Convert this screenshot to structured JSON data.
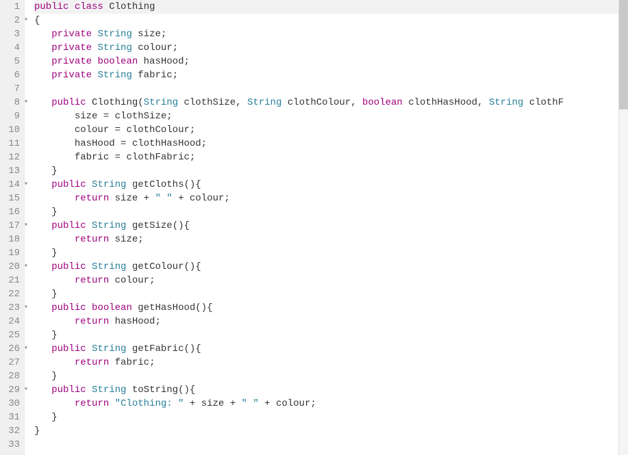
{
  "editor": {
    "activeLine": 1,
    "lines": [
      {
        "num": 1,
        "fold": "",
        "tokens": [
          [
            "kw",
            "public"
          ],
          [
            "",
            null
          ],
          [
            "kw",
            "class"
          ],
          [
            "",
            null
          ],
          [
            "ident",
            "Clothing"
          ]
        ]
      },
      {
        "num": 2,
        "fold": "▾",
        "tokens": [
          [
            "punc",
            "{"
          ]
        ]
      },
      {
        "num": 3,
        "fold": "",
        "tokens": [
          [
            "",
            "   "
          ],
          [
            "kw",
            "private"
          ],
          [
            "",
            null
          ],
          [
            "type",
            "String"
          ],
          [
            "",
            null
          ],
          [
            "ident",
            "size"
          ],
          [
            "punc",
            ";"
          ]
        ]
      },
      {
        "num": 4,
        "fold": "",
        "tokens": [
          [
            "",
            "   "
          ],
          [
            "kw",
            "private"
          ],
          [
            "",
            null
          ],
          [
            "type",
            "String"
          ],
          [
            "",
            null
          ],
          [
            "ident",
            "colour"
          ],
          [
            "punc",
            ";"
          ]
        ]
      },
      {
        "num": 5,
        "fold": "",
        "tokens": [
          [
            "",
            "   "
          ],
          [
            "kw",
            "private"
          ],
          [
            "",
            null
          ],
          [
            "kw",
            "boolean"
          ],
          [
            "",
            null
          ],
          [
            "ident",
            "hasHood"
          ],
          [
            "punc",
            ";"
          ]
        ]
      },
      {
        "num": 6,
        "fold": "",
        "tokens": [
          [
            "",
            "   "
          ],
          [
            "kw",
            "private"
          ],
          [
            "",
            null
          ],
          [
            "type",
            "String"
          ],
          [
            "",
            null
          ],
          [
            "ident",
            "fabric"
          ],
          [
            "punc",
            ";"
          ]
        ]
      },
      {
        "num": 7,
        "fold": "",
        "tokens": []
      },
      {
        "num": 8,
        "fold": "▾",
        "tokens": [
          [
            "",
            "   "
          ],
          [
            "kw",
            "public"
          ],
          [
            "",
            null
          ],
          [
            "ident",
            "Clothing"
          ],
          [
            "punc",
            "("
          ],
          [
            "type",
            "String"
          ],
          [
            "",
            null
          ],
          [
            "ident",
            "clothSize"
          ],
          [
            "punc",
            ","
          ],
          [
            "",
            null
          ],
          [
            "type",
            "String"
          ],
          [
            "",
            null
          ],
          [
            "ident",
            "clothColour"
          ],
          [
            "punc",
            ","
          ],
          [
            "",
            null
          ],
          [
            "kw",
            "boolean"
          ],
          [
            "",
            null
          ],
          [
            "ident",
            "clothHasHood"
          ],
          [
            "punc",
            ","
          ],
          [
            "",
            null
          ],
          [
            "type",
            "String"
          ],
          [
            "",
            null
          ],
          [
            "ident",
            "clothF"
          ]
        ]
      },
      {
        "num": 9,
        "fold": "",
        "tokens": [
          [
            "",
            "       "
          ],
          [
            "ident",
            "size"
          ],
          [
            "",
            null
          ],
          [
            "op",
            "="
          ],
          [
            "",
            null
          ],
          [
            "ident",
            "clothSize"
          ],
          [
            "punc",
            ";"
          ]
        ]
      },
      {
        "num": 10,
        "fold": "",
        "tokens": [
          [
            "",
            "       "
          ],
          [
            "ident",
            "colour"
          ],
          [
            "",
            null
          ],
          [
            "op",
            "="
          ],
          [
            "",
            null
          ],
          [
            "ident",
            "clothColour"
          ],
          [
            "punc",
            ";"
          ]
        ]
      },
      {
        "num": 11,
        "fold": "",
        "tokens": [
          [
            "",
            "       "
          ],
          [
            "ident",
            "hasHood"
          ],
          [
            "",
            null
          ],
          [
            "op",
            "="
          ],
          [
            "",
            null
          ],
          [
            "ident",
            "clothHasHood"
          ],
          [
            "punc",
            ";"
          ]
        ]
      },
      {
        "num": 12,
        "fold": "",
        "tokens": [
          [
            "",
            "       "
          ],
          [
            "ident",
            "fabric"
          ],
          [
            "",
            null
          ],
          [
            "op",
            "="
          ],
          [
            "",
            null
          ],
          [
            "ident",
            "clothFabric"
          ],
          [
            "punc",
            ";"
          ]
        ]
      },
      {
        "num": 13,
        "fold": "",
        "tokens": [
          [
            "",
            "   "
          ],
          [
            "punc",
            "}"
          ]
        ]
      },
      {
        "num": 14,
        "fold": "▾",
        "tokens": [
          [
            "",
            "   "
          ],
          [
            "kw",
            "public"
          ],
          [
            "",
            null
          ],
          [
            "type",
            "String"
          ],
          [
            "",
            null
          ],
          [
            "ident",
            "getCloths"
          ],
          [
            "punc",
            "(){"
          ]
        ]
      },
      {
        "num": 15,
        "fold": "",
        "tokens": [
          [
            "",
            "       "
          ],
          [
            "kw",
            "return"
          ],
          [
            "",
            null
          ],
          [
            "ident",
            "size"
          ],
          [
            "",
            null
          ],
          [
            "op",
            "+"
          ],
          [
            "",
            null
          ],
          [
            "str",
            "\" \""
          ],
          [
            "",
            null
          ],
          [
            "op",
            "+"
          ],
          [
            "",
            null
          ],
          [
            "ident",
            "colour"
          ],
          [
            "punc",
            ";"
          ]
        ]
      },
      {
        "num": 16,
        "fold": "",
        "tokens": [
          [
            "",
            "   "
          ],
          [
            "punc",
            "}"
          ]
        ]
      },
      {
        "num": 17,
        "fold": "▾",
        "tokens": [
          [
            "",
            "   "
          ],
          [
            "kw",
            "public"
          ],
          [
            "",
            null
          ],
          [
            "type",
            "String"
          ],
          [
            "",
            null
          ],
          [
            "ident",
            "getSize"
          ],
          [
            "punc",
            "(){"
          ]
        ]
      },
      {
        "num": 18,
        "fold": "",
        "tokens": [
          [
            "",
            "       "
          ],
          [
            "kw",
            "return"
          ],
          [
            "",
            null
          ],
          [
            "ident",
            "size"
          ],
          [
            "punc",
            ";"
          ]
        ]
      },
      {
        "num": 19,
        "fold": "",
        "tokens": [
          [
            "",
            "   "
          ],
          [
            "punc",
            "}"
          ]
        ]
      },
      {
        "num": 20,
        "fold": "▾",
        "tokens": [
          [
            "",
            "   "
          ],
          [
            "kw",
            "public"
          ],
          [
            "",
            null
          ],
          [
            "type",
            "String"
          ],
          [
            "",
            null
          ],
          [
            "ident",
            "getColour"
          ],
          [
            "punc",
            "(){"
          ]
        ]
      },
      {
        "num": 21,
        "fold": "",
        "tokens": [
          [
            "",
            "       "
          ],
          [
            "kw",
            "return"
          ],
          [
            "",
            null
          ],
          [
            "ident",
            "colour"
          ],
          [
            "punc",
            ";"
          ]
        ]
      },
      {
        "num": 22,
        "fold": "",
        "tokens": [
          [
            "",
            "   "
          ],
          [
            "punc",
            "}"
          ]
        ]
      },
      {
        "num": 23,
        "fold": "▾",
        "tokens": [
          [
            "",
            "   "
          ],
          [
            "kw",
            "public"
          ],
          [
            "",
            null
          ],
          [
            "kw",
            "boolean"
          ],
          [
            "",
            null
          ],
          [
            "ident",
            "getHasHood"
          ],
          [
            "punc",
            "(){"
          ]
        ]
      },
      {
        "num": 24,
        "fold": "",
        "tokens": [
          [
            "",
            "       "
          ],
          [
            "kw",
            "return"
          ],
          [
            "",
            null
          ],
          [
            "ident",
            "hasHood"
          ],
          [
            "punc",
            ";"
          ]
        ]
      },
      {
        "num": 25,
        "fold": "",
        "tokens": [
          [
            "",
            "   "
          ],
          [
            "punc",
            "}"
          ]
        ]
      },
      {
        "num": 26,
        "fold": "▾",
        "tokens": [
          [
            "",
            "   "
          ],
          [
            "kw",
            "public"
          ],
          [
            "",
            null
          ],
          [
            "type",
            "String"
          ],
          [
            "",
            null
          ],
          [
            "ident",
            "getFabric"
          ],
          [
            "punc",
            "(){"
          ]
        ]
      },
      {
        "num": 27,
        "fold": "",
        "tokens": [
          [
            "",
            "       "
          ],
          [
            "kw",
            "return"
          ],
          [
            "",
            null
          ],
          [
            "ident",
            "fabric"
          ],
          [
            "punc",
            ";"
          ]
        ]
      },
      {
        "num": 28,
        "fold": "",
        "tokens": [
          [
            "",
            "   "
          ],
          [
            "punc",
            "}"
          ]
        ]
      },
      {
        "num": 29,
        "fold": "▾",
        "tokens": [
          [
            "",
            "   "
          ],
          [
            "kw",
            "public"
          ],
          [
            "",
            null
          ],
          [
            "type",
            "String"
          ],
          [
            "",
            null
          ],
          [
            "ident",
            "toString"
          ],
          [
            "punc",
            "(){"
          ]
        ]
      },
      {
        "num": 30,
        "fold": "",
        "tokens": [
          [
            "",
            "       "
          ],
          [
            "kw",
            "return"
          ],
          [
            "",
            null
          ],
          [
            "str",
            "\"Clothing: \""
          ],
          [
            "",
            null
          ],
          [
            "op",
            "+"
          ],
          [
            "",
            null
          ],
          [
            "ident",
            "size"
          ],
          [
            "",
            null
          ],
          [
            "op",
            "+"
          ],
          [
            "",
            null
          ],
          [
            "str",
            "\" \""
          ],
          [
            "",
            null
          ],
          [
            "op",
            "+"
          ],
          [
            "",
            null
          ],
          [
            "ident",
            "colour"
          ],
          [
            "punc",
            ";"
          ]
        ]
      },
      {
        "num": 31,
        "fold": "",
        "tokens": [
          [
            "",
            "   "
          ],
          [
            "punc",
            "}"
          ]
        ]
      },
      {
        "num": 32,
        "fold": "",
        "tokens": [
          [
            "punc",
            "}"
          ]
        ]
      },
      {
        "num": 33,
        "fold": "",
        "tokens": []
      }
    ]
  }
}
